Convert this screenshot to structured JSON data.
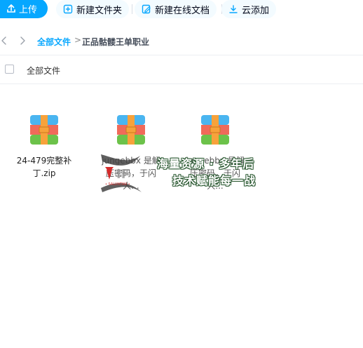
{
  "toolbar": {
    "upload_label": "上传",
    "new_folder_label": "新建文件夹",
    "new_online_doc_label": "新建在线文档",
    "cloud_add_label": "云添加"
  },
  "breadcrumb": {
    "root": "全部文件",
    "separator": ">",
    "current": "正品骷髅王单职业"
  },
  "list_header": {
    "label": "全部文件"
  },
  "files": [
    {
      "name": "24-479完整补丁.zip",
      "icon": "archive-icon"
    },
    {
      "name": "jungebbx 是解压密码，于闪人...",
      "icon": "archive-icon"
    },
    {
      "name": "jungebbx 是解压密码，于闪人...",
      "icon": "archive-icon"
    }
  ],
  "watermark": {
    "line1": "海量资源 · 多年后",
    "line2": "技术赋能每一战"
  },
  "colors": {
    "accent": "#06a7ff",
    "archive_top": "#4ab5f0",
    "archive_mid": "#f06a5a",
    "archive_bottom": "#6cc24a",
    "archive_strap": "#f7a23b"
  }
}
